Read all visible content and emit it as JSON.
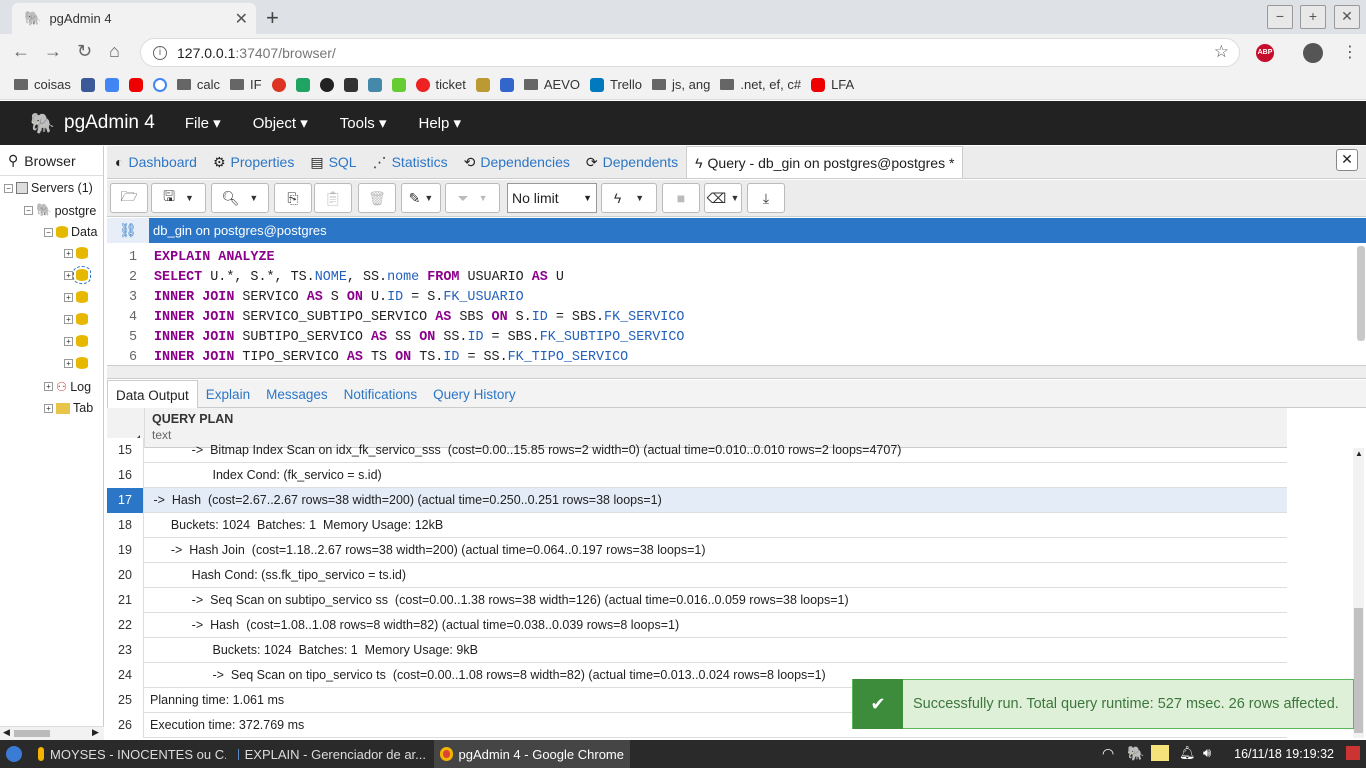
{
  "chrome": {
    "tab_title": "pgAdmin 4",
    "tab_close": "✕",
    "new_tab": "+",
    "win_min": "−",
    "win_max": "+",
    "win_close": "✕",
    "url_host": "127.0.0.1",
    "url_path": ":37407/browser/",
    "bookmarks": [
      "coisas",
      "calc",
      "IF",
      "ticket",
      "AEVO",
      "Trello",
      "js, ang",
      ".net, ef, c#",
      "LFA"
    ],
    "abp": "ABP"
  },
  "pgadmin": {
    "brand": "pgAdmin 4",
    "menus": [
      "File ▾",
      "Object ▾",
      "Tools ▾",
      "Help ▾"
    ]
  },
  "browser_panel": {
    "title": "Browser",
    "servers": "Servers (1)",
    "server": "postgre",
    "databases": "Data",
    "login": "Log",
    "tablespaces": "Tab"
  },
  "main_tabs": [
    "Dashboard",
    "Properties",
    "SQL",
    "Statistics",
    "Dependencies",
    "Dependents",
    "Query - db_gin on postgres@postgres *"
  ],
  "toolbar": {
    "limit": "No limit"
  },
  "connection": "db_gin on postgres@postgres",
  "editor": {
    "line_numbers": [
      "1",
      "2",
      "3",
      "4",
      "5",
      "6"
    ]
  },
  "result_tabs": [
    "Data Output",
    "Explain",
    "Messages",
    "Notifications",
    "Query History"
  ],
  "grid": {
    "column_name": "QUERY PLAN",
    "column_type": "text",
    "rows": [
      {
        "n": "15",
        "v": "            ->  Bitmap Index Scan on idx_fk_servico_sss  (cost=0.00..15.85 rows=2 width=0) (actual time=0.010..0.010 rows=2 loops=4707)"
      },
      {
        "n": "16",
        "v": "                  Index Cond: (fk_servico = s.id)"
      },
      {
        "n": "17",
        "v": " ->  Hash  (cost=2.67..2.67 rows=38 width=200) (actual time=0.250..0.251 rows=38 loops=1)"
      },
      {
        "n": "18",
        "v": "      Buckets: 1024  Batches: 1  Memory Usage: 12kB"
      },
      {
        "n": "19",
        "v": "      ->  Hash Join  (cost=1.18..2.67 rows=38 width=200) (actual time=0.064..0.197 rows=38 loops=1)"
      },
      {
        "n": "20",
        "v": "            Hash Cond: (ss.fk_tipo_servico = ts.id)"
      },
      {
        "n": "21",
        "v": "            ->  Seq Scan on subtipo_servico ss  (cost=0.00..1.38 rows=38 width=126) (actual time=0.016..0.059 rows=38 loops=1)"
      },
      {
        "n": "22",
        "v": "            ->  Hash  (cost=1.08..1.08 rows=8 width=82) (actual time=0.038..0.039 rows=8 loops=1)"
      },
      {
        "n": "23",
        "v": "                  Buckets: 1024  Batches: 1  Memory Usage: 9kB"
      },
      {
        "n": "24",
        "v": "                  ->  Seq Scan on tipo_servico ts  (cost=0.00..1.08 rows=8 width=82) (actual time=0.013..0.024 rows=8 loops=1)"
      },
      {
        "n": "25",
        "v": "Planning time: 1.061 ms"
      },
      {
        "n": "26",
        "v": "Execution time: 372.769 ms"
      }
    ],
    "selected_row": "17"
  },
  "toast": "Successfully run. Total query runtime: 527 msec. 26 rows affected.",
  "taskbar": {
    "tasks": [
      "MOYSES - INOCENTES ou C...",
      "EXPLAIN - Gerenciador de ar...",
      "pgAdmin 4 - Google Chrome"
    ],
    "clock": "16/11/18 19:19:32"
  },
  "colors": {
    "accent": "#2c76c7",
    "header": "#222222",
    "toast": "#dff0d8"
  }
}
